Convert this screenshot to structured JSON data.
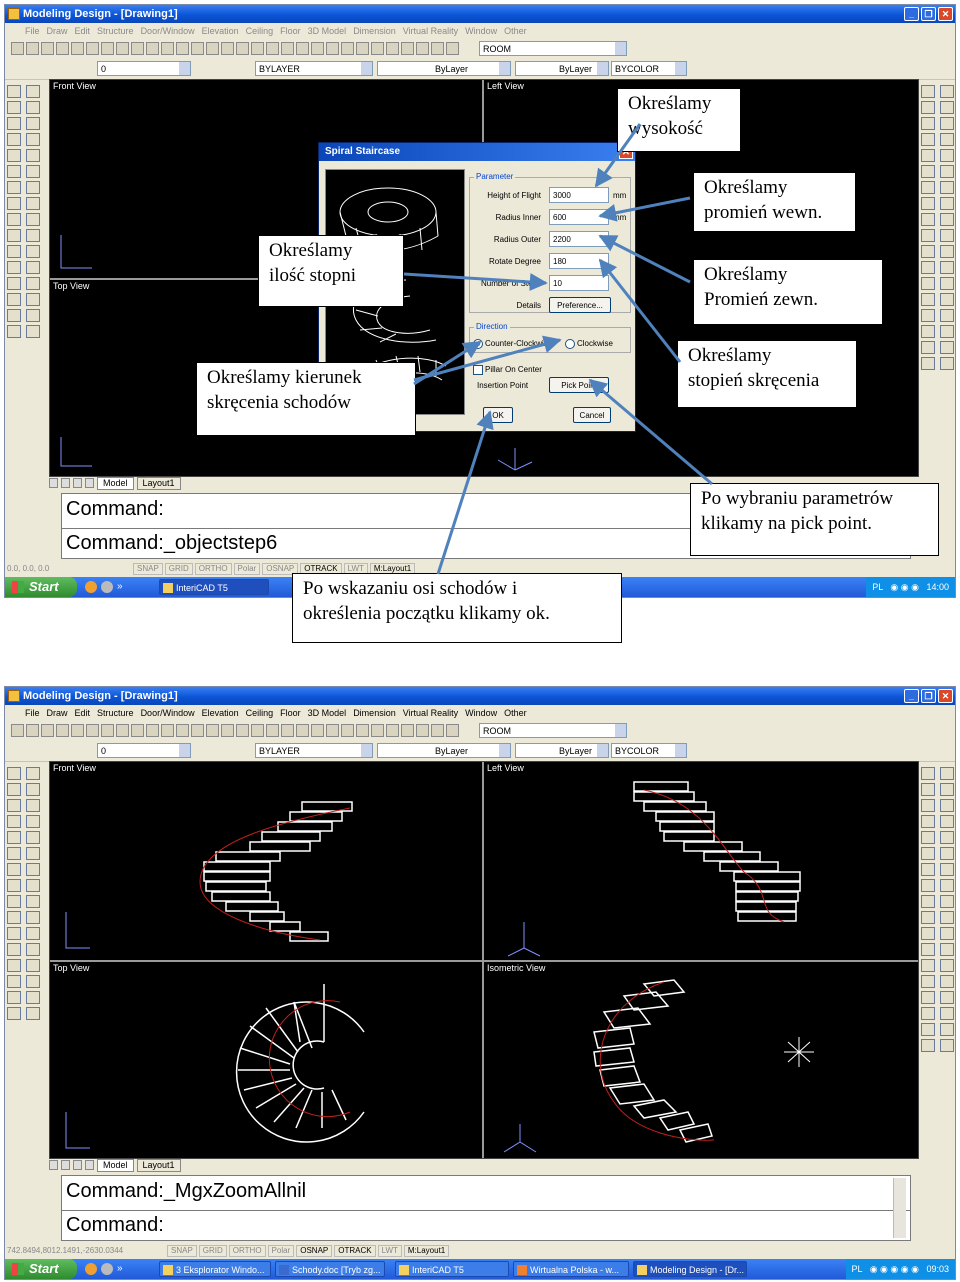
{
  "shot1": {
    "window_title": "Modeling Design - [Drawing1]",
    "menu": [
      "File",
      "Draw",
      "Edit",
      "Structure",
      "Door/Window",
      "Elevation",
      "Ceiling",
      "Floor",
      "3D Model",
      "Dimension",
      "Virtual Reality",
      "Window",
      "Other"
    ],
    "toolbar": {
      "room_field": "ROOM",
      "layer_zero": "0",
      "layer_combo": "BYLAYER",
      "linetype": "ByLayer",
      "lineweight": "ByLayer",
      "color": "BYCOLOR"
    },
    "viewports": {
      "front": "Front View",
      "left": "Left View",
      "top": "Top View"
    },
    "tabs": [
      "Model",
      "Layout1"
    ],
    "command_lines": [
      "Command:",
      "Command:_objectstep6"
    ],
    "status_coords": "0.0, 0.0, 0.0",
    "status_buttons": [
      "SNAP",
      "GRID",
      "ORTHO",
      "Polar",
      "OSNAP",
      "OTRACK",
      "LWT",
      "M:Layout1"
    ],
    "taskbar": {
      "start": "Start",
      "items": [
        "InteriCAD T5"
      ],
      "tray_lang": "PL",
      "clock": "14:00"
    },
    "dialog": {
      "title": "Spiral Staircase",
      "parameter_group": "Parameter",
      "fields": [
        {
          "label": "Height of Flight",
          "value": "3000",
          "unit": "mm"
        },
        {
          "label": "Radius Inner",
          "value": "600",
          "unit": "mm"
        },
        {
          "label": "Radius Outer",
          "value": "2200",
          "unit": ""
        },
        {
          "label": "Rotate Degree",
          "value": "180",
          "unit": ""
        },
        {
          "label": "Number of Steps",
          "value": "10",
          "unit": ""
        }
      ],
      "details_label": "Details",
      "preference_button": "Preference...",
      "direction_group": "Direction",
      "radio_ccw": "Counter-Clockwise",
      "radio_cw": "Clockwise",
      "pillar_checkbox": "Pillar On Center",
      "insertion_label": "Insertion Point",
      "pick_point_button": "Pick Point",
      "ok_button": "OK",
      "cancel_button": "Cancel"
    },
    "annotations": {
      "height": "Określamy\nwysokość",
      "inner": "Określamy\npromień wewn.",
      "outer": "Określamy\nPromień zewn.",
      "rotation": "Określamy\nstopień skręcenia",
      "steps": "Określamy\nilość stopni",
      "direction": "Określamy kierunek\nskręcenia schodów",
      "pick_point": "Po wybraniu parametrów\nklikamy na pick point.",
      "ok": "Po wskazaniu osi schodów i\nokreślenia początku  klikamy ok."
    }
  },
  "shot2": {
    "window_title": "Modeling Design - [Drawing1]",
    "menu": [
      "File",
      "Draw",
      "Edit",
      "Structure",
      "Door/Window",
      "Elevation",
      "Ceiling",
      "Floor",
      "3D Model",
      "Dimension",
      "Virtual Reality",
      "Window",
      "Other"
    ],
    "toolbar": {
      "room_field": "ROOM",
      "layer_zero": "0",
      "layer_combo": "BYLAYER",
      "linetype": "ByLayer",
      "lineweight": "ByLayer",
      "color": "BYCOLOR"
    },
    "viewports": {
      "front": "Front View",
      "left": "Left View",
      "top": "Top View",
      "iso": "Isometric View"
    },
    "tabs": [
      "Model",
      "Layout1"
    ],
    "command_lines": [
      "Command:_MgxZoomAllnil",
      "Command:"
    ],
    "status_coords": "742.8494,8012.1491,-2630.0344",
    "status_buttons": [
      "SNAP",
      "GRID",
      "ORTHO",
      "Polar",
      "OSNAP",
      "OTRACK",
      "LWT",
      "M:Layout1"
    ],
    "taskbar": {
      "start": "Start",
      "items": [
        "3 Eksplorator Windo...",
        "Schody.doc [Tryb zg...",
        "InteriCAD T5",
        "Wirtualna Polska - w...",
        "Modeling Design - [Dr..."
      ],
      "tray_lang": "PL",
      "clock": "09:03"
    }
  },
  "colors": {
    "title_blue": "#0b55d8",
    "canvas": "#000000",
    "arrow_blue": "#4f81bd",
    "stair_red": "#c0201c"
  }
}
